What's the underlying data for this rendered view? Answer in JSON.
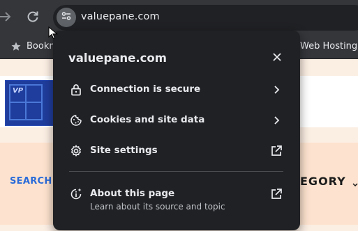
{
  "browser": {
    "url": "valuepane.com",
    "bookmarks": [
      {
        "label": "Bookm",
        "icon": "star-icon"
      },
      {
        "label": "Web Hosting"
      }
    ]
  },
  "page": {
    "search_link": "SEARCH",
    "category_label": "EGORY",
    "logo_text": "VP"
  },
  "popup": {
    "title": "valuepane.com",
    "items": [
      {
        "label": "Connection is secure",
        "icon": "lock-icon",
        "trailing": "chevron-right-icon"
      },
      {
        "label": "Cookies and site data",
        "icon": "cookie-icon",
        "trailing": "chevron-right-icon"
      },
      {
        "label": "Site settings",
        "icon": "gear-icon",
        "trailing": "open-external-icon"
      }
    ],
    "about": {
      "label": "About this page",
      "sublabel": "Learn about its source and topic",
      "icon": "info-sparkle-icon",
      "trailing": "open-external-icon"
    }
  },
  "colors": {
    "chrome": "#35363a",
    "popup_bg": "#202124",
    "text": "#e8eaed",
    "link_blue": "#2a6bd9",
    "logo_blue": "#1f3d9c",
    "page_peach": "#fde3cf"
  }
}
